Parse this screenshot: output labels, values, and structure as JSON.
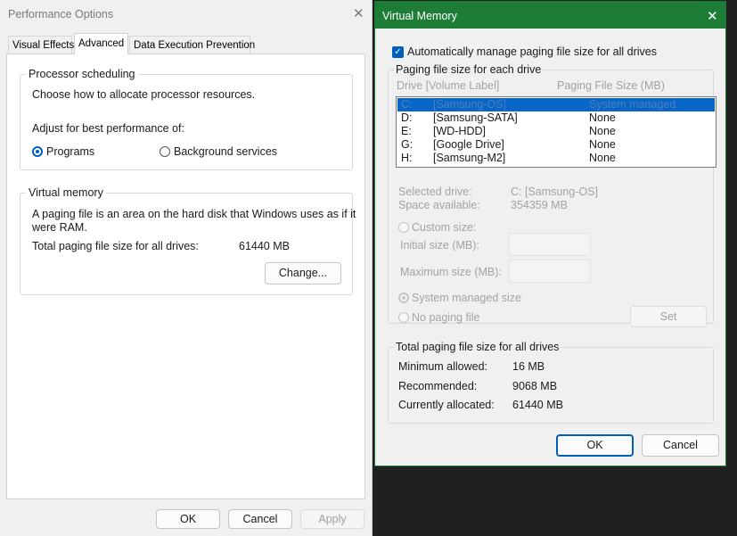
{
  "performance_options": {
    "title": "Performance Options",
    "tabs": [
      "Visual Effects",
      "Advanced",
      "Data Execution Prevention"
    ],
    "processor": {
      "group_label": "Processor scheduling",
      "description": "Choose how to allocate processor resources.",
      "adjust_label": "Adjust for best performance of:",
      "option_programs": "Programs",
      "option_background": "Background services",
      "selected": "Programs"
    },
    "virtual_memory": {
      "group_label": "Virtual memory",
      "description_line1": "A paging file is an area on the hard disk that Windows uses as if it",
      "description_line2": "were RAM.",
      "total_label": "Total paging file size for all drives:",
      "total_value": "61440 MB",
      "change_button": "Change..."
    },
    "buttons": {
      "ok": "OK",
      "cancel": "Cancel",
      "apply": "Apply"
    }
  },
  "virtual_memory_dialog": {
    "title": "Virtual Memory",
    "auto_manage_label": "Automatically manage paging file size for all drives",
    "auto_manage_checked": true,
    "paging_group_label": "Paging file size for each drive",
    "columns": {
      "drive": "Drive  [Volume Label]",
      "size": "Paging File Size (MB)"
    },
    "drives": [
      {
        "drive": "C:",
        "label": "[Samsung-OS]",
        "size": "System managed",
        "selected": true
      },
      {
        "drive": "D:",
        "label": "[Samsung-SATA]",
        "size": "None"
      },
      {
        "drive": "E:",
        "label": "[WD-HDD]",
        "size": "None"
      },
      {
        "drive": "G:",
        "label": "[Google Drive]",
        "size": "None"
      },
      {
        "drive": "H:",
        "label": "[Samsung-M2]",
        "size": "None"
      }
    ],
    "selected_drive_label": "Selected drive:",
    "selected_drive_value": "C:  [Samsung-OS]",
    "space_available_label": "Space available:",
    "space_available_value": "354359 MB",
    "custom_size_label": "Custom size:",
    "initial_size_label": "Initial size (MB):",
    "maximum_size_label": "Maximum size (MB):",
    "system_managed_label": "System managed size",
    "no_paging_label": "No paging file",
    "set_button": "Set",
    "totals": {
      "group_label": "Total paging file size for all drives",
      "minimum_label": "Minimum allowed:",
      "minimum_value": "16 MB",
      "recommended_label": "Recommended:",
      "recommended_value": "9068 MB",
      "allocated_label": "Currently allocated:",
      "allocated_value": "61440 MB"
    },
    "ok_button": "OK",
    "cancel_button": "Cancel"
  },
  "colors": {
    "accent": "#005fb8",
    "titlebar": "#1d7d37",
    "selection": "#0a66c6"
  },
  "icons": {
    "close": "close-icon",
    "checkmark": "check-icon"
  }
}
